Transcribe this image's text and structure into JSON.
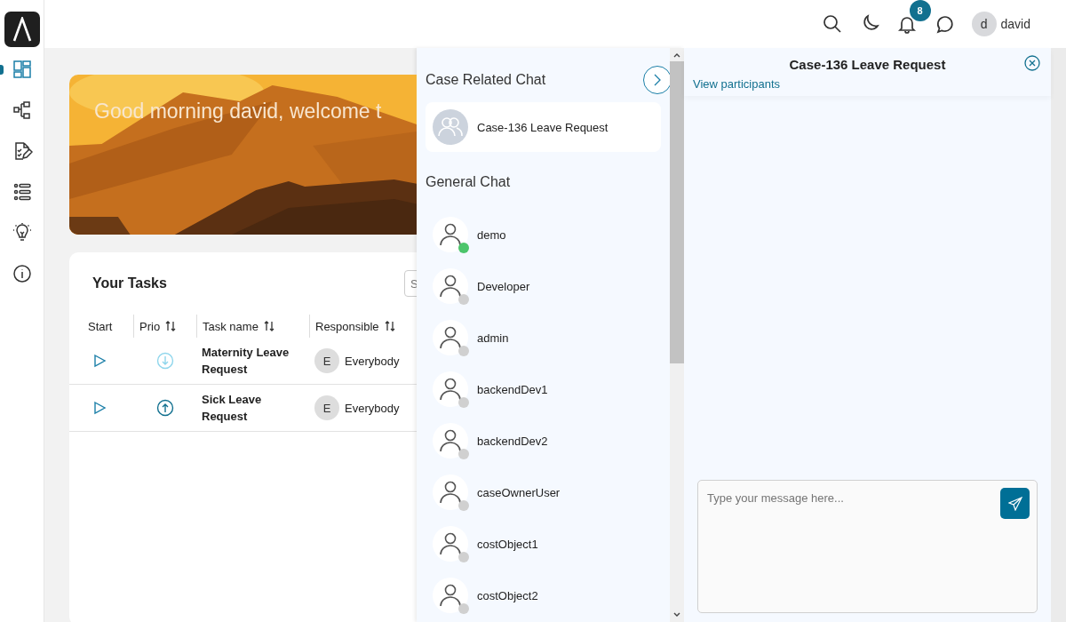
{
  "sidebar": {
    "items": [
      {
        "kind": "dashboard",
        "selected": true
      },
      {
        "kind": "process",
        "selected": false
      },
      {
        "kind": "tasks",
        "selected": false
      },
      {
        "kind": "list",
        "selected": false
      },
      {
        "kind": "idea",
        "selected": false
      },
      {
        "kind": "info",
        "selected": false
      }
    ]
  },
  "topbar": {
    "notification_count": "8",
    "avatar_initial": "d",
    "user_name": "david"
  },
  "banner": {
    "greeting": "Good morning david, welcome t"
  },
  "tasks": {
    "title": "Your Tasks",
    "search_placeholder": "S",
    "columns": [
      {
        "label": "Start",
        "sortable": false
      },
      {
        "label": "Prio",
        "sortable": true
      },
      {
        "label": "Task name",
        "sortable": true
      },
      {
        "label": "Responsible",
        "sortable": true
      }
    ],
    "rows": [
      {
        "kind": "low",
        "name": "Maternity Leave Request",
        "responsible_initial": "E",
        "responsible": "Everybody"
      },
      {
        "kind": "high",
        "name": "Sick Leave Request",
        "responsible_initial": "E",
        "responsible": "Everybody"
      }
    ]
  },
  "chat_list": {
    "case_title": "Case Related Chat",
    "case_chats": [
      {
        "name": "Case-136 Leave Request"
      }
    ],
    "general_title": "General Chat",
    "users": [
      {
        "name": "demo",
        "online": true
      },
      {
        "name": "Developer",
        "online": false
      },
      {
        "name": "admin",
        "online": false
      },
      {
        "name": "backendDev1",
        "online": false
      },
      {
        "name": "backendDev2",
        "online": false
      },
      {
        "name": "caseOwnerUser",
        "online": false
      },
      {
        "name": "costObject1",
        "online": false
      },
      {
        "name": "costObject2",
        "online": false
      }
    ]
  },
  "conversation": {
    "title": "Case-136 Leave Request",
    "participants_link": "View participants",
    "message_placeholder": "Type your message here..."
  }
}
